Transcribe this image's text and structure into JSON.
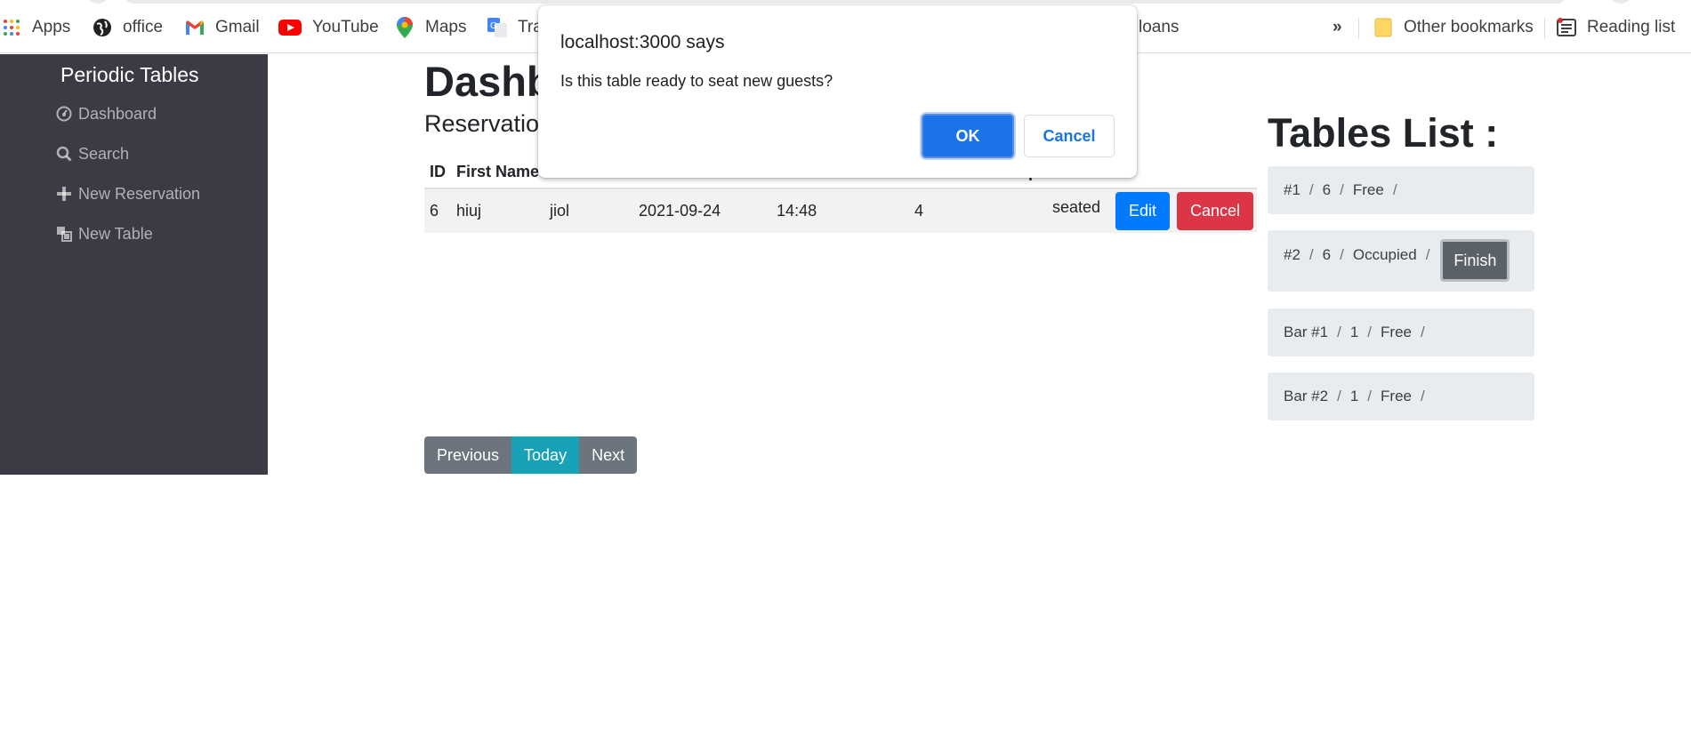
{
  "bookmarks": {
    "apps": "Apps",
    "office": "office",
    "gmail": "Gmail",
    "youtube": "YouTube",
    "maps": "Maps",
    "translate": "Tra",
    "loans": "loans",
    "more": "»",
    "other_bookmarks": "Other bookmarks",
    "reading_list": "Reading list"
  },
  "sidebar": {
    "brand": "Periodic Tables",
    "items": [
      {
        "label": "Dashboard",
        "icon": "dashboard-icon"
      },
      {
        "label": "Search",
        "icon": "search-icon"
      },
      {
        "label": "New Reservation",
        "icon": "plus-icon"
      },
      {
        "label": "New Table",
        "icon": "table-icon"
      }
    ]
  },
  "main": {
    "title": "Dashb",
    "subtitle": "Reservatio",
    "columns": [
      "ID",
      "First Name"
    ],
    "column_partial": "p",
    "rows": [
      {
        "id": "6",
        "first_name": "hiuj",
        "last_name": "jiol",
        "date": "2021-09-24",
        "time": "14:48",
        "people": "4",
        "status": "seated",
        "edit_label": "Edit",
        "cancel_label": "Cancel"
      }
    ],
    "pager": {
      "previous": "Previous",
      "today": "Today",
      "next": "Next"
    }
  },
  "tables_list": {
    "title": "Tables List :",
    "tables": [
      {
        "name": "#1",
        "capacity": "6",
        "status": "Free",
        "action": null
      },
      {
        "name": "#2",
        "capacity": "6",
        "status": "Occupied",
        "action": "Finish"
      },
      {
        "name": "Bar #1",
        "capacity": "1",
        "status": "Free",
        "action": null
      },
      {
        "name": "Bar #2",
        "capacity": "1",
        "status": "Free",
        "action": null
      }
    ]
  },
  "dialog": {
    "origin": "localhost:3000 says",
    "message": "Is this table ready to seat new guests?",
    "ok": "OK",
    "cancel": "Cancel"
  },
  "colors": {
    "sidebar_bg": "#3a3b45",
    "primary": "#007bff",
    "danger": "#dc3545",
    "secondary": "#6c757d",
    "info": "#17a2b8",
    "dialog_button": "#1a73e8"
  }
}
